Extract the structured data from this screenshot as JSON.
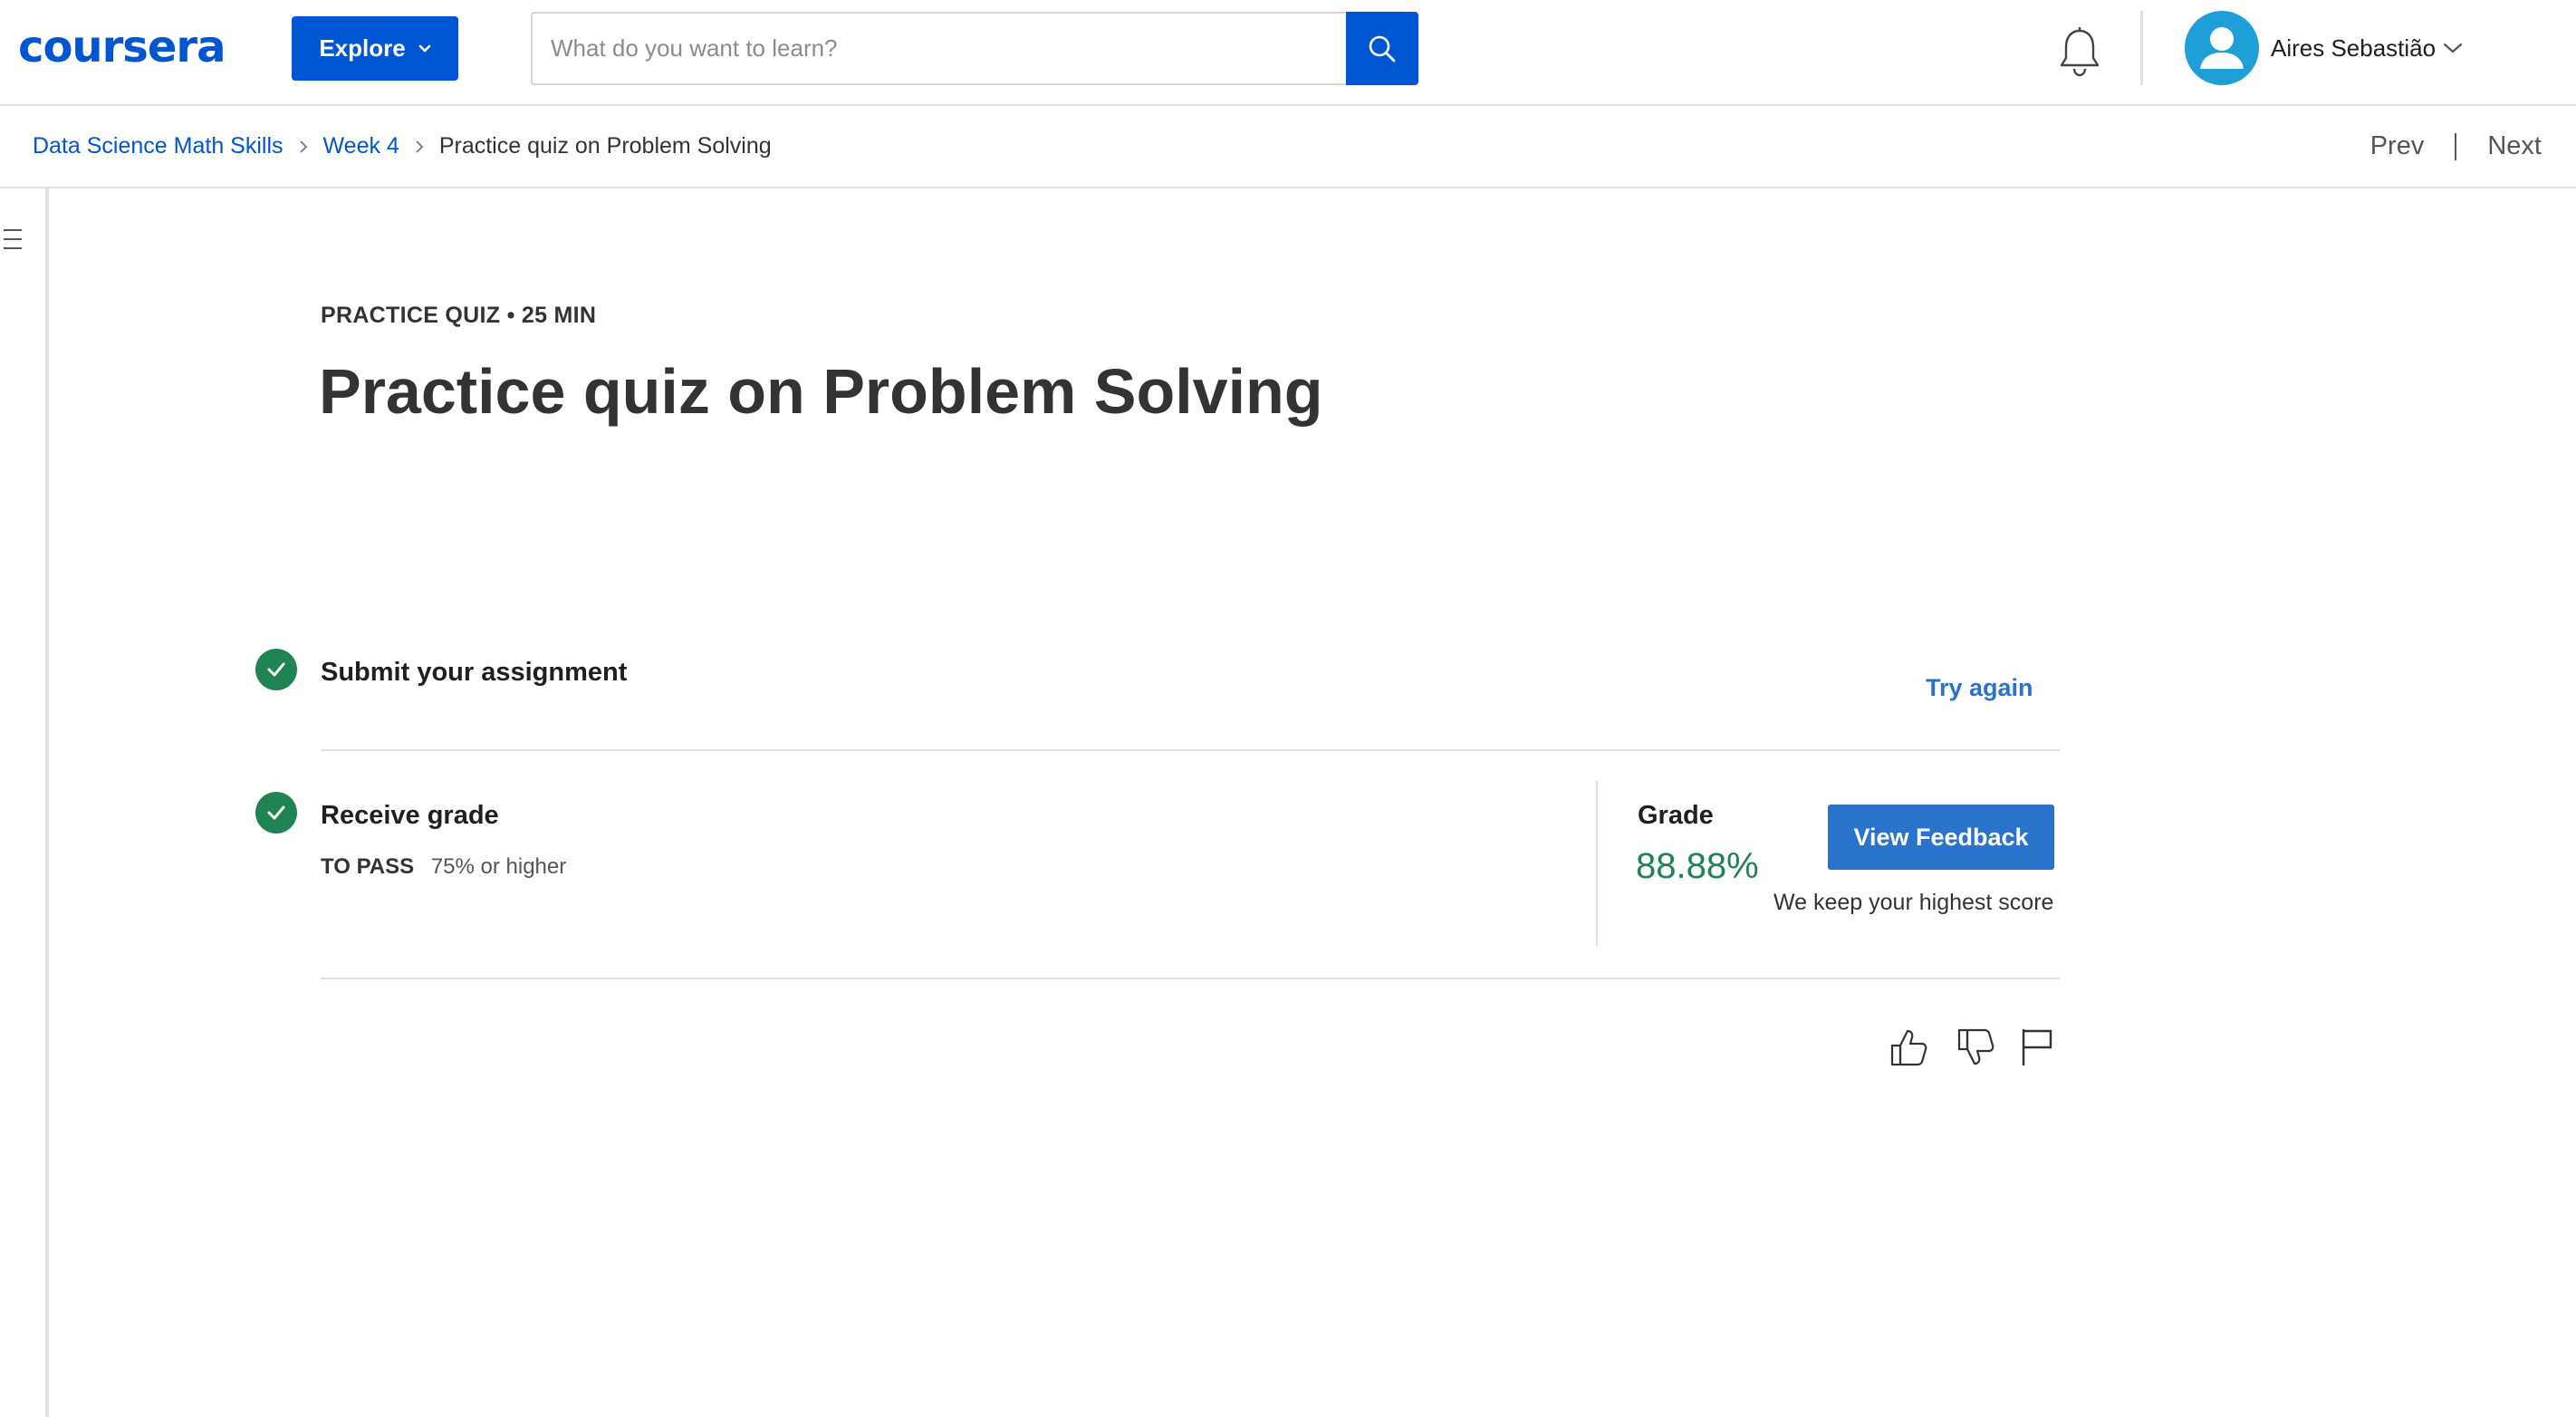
{
  "header": {
    "logo": "coursera",
    "explore_label": "Explore",
    "search_placeholder": "What do you want to learn?",
    "user_name": "Aires Sebastião"
  },
  "breadcrumb": {
    "items": [
      "Data Science Math Skills",
      "Week 4"
    ],
    "current": "Practice quiz on Problem Solving"
  },
  "nav": {
    "prev": "Prev",
    "next": "Next"
  },
  "quiz": {
    "eyebrow": "PRACTICE QUIZ • 25 MIN",
    "title": "Practice quiz on Problem Solving"
  },
  "steps": {
    "submit": {
      "title": "Submit your assignment",
      "action": "Try again"
    },
    "receive": {
      "title": "Receive grade",
      "to_pass_label": "TO PASS",
      "to_pass_value": "75% or higher"
    }
  },
  "grade": {
    "label": "Grade",
    "value": "88.88%",
    "button": "View Feedback",
    "note": "We keep your highest score"
  },
  "colors": {
    "brand": "#0056d2",
    "link": "#2a73cc",
    "success": "#1f8354",
    "avatar": "#1f9fd8"
  },
  "icons": [
    "chevron-down-icon",
    "search-icon",
    "bell-icon",
    "user-avatar-icon",
    "chevron-right-icon",
    "menu-icon",
    "check-icon",
    "thumbs-up-icon",
    "thumbs-down-icon",
    "flag-icon"
  ]
}
